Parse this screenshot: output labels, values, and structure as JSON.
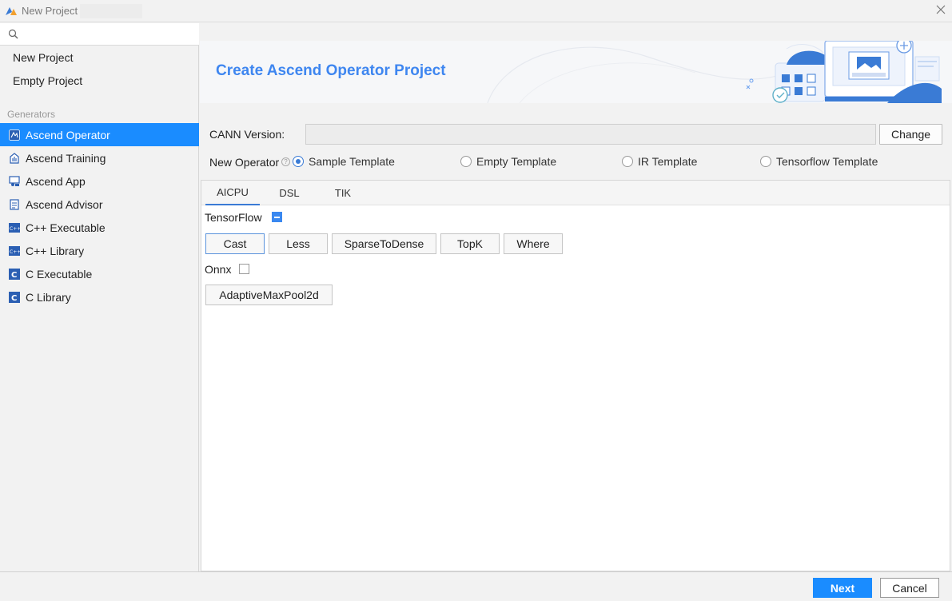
{
  "window": {
    "title": "New Project",
    "app_icon": "ascend-logo-icon",
    "close_icon": "close-icon"
  },
  "sidebar": {
    "search_icon": "search-icon",
    "search_placeholder": "",
    "projects": [
      {
        "label": "New Project"
      },
      {
        "label": "Empty Project"
      }
    ],
    "generators_label": "Generators",
    "generators": [
      {
        "label": "Ascend Operator",
        "icon": "ascend-operator-icon",
        "selected": true
      },
      {
        "label": "Ascend Training",
        "icon": "ascend-training-icon"
      },
      {
        "label": "Ascend App",
        "icon": "ascend-app-icon"
      },
      {
        "label": "Ascend Advisor",
        "icon": "ascend-advisor-icon"
      },
      {
        "label": "C++ Executable",
        "icon": "cpp-icon"
      },
      {
        "label": "C++ Library",
        "icon": "cpp-icon"
      },
      {
        "label": "C Executable",
        "icon": "c-icon"
      },
      {
        "label": "C Library",
        "icon": "c-icon"
      }
    ]
  },
  "banner": {
    "title": "Create Ascend Operator Project"
  },
  "form": {
    "cann_label": "CANN Version:",
    "cann_value": "",
    "change_label": "Change",
    "new_operator_label": "New Operator",
    "templates": [
      {
        "label": "Sample Template",
        "selected": true
      },
      {
        "label": "Empty Template",
        "selected": false
      },
      {
        "label": "IR Template",
        "selected": false
      },
      {
        "label": "Tensorflow Template",
        "selected": false
      }
    ]
  },
  "tabs": [
    {
      "label": "AICPU",
      "active": true
    },
    {
      "label": "DSL",
      "active": false
    },
    {
      "label": "TIK",
      "active": false
    }
  ],
  "groups": {
    "tensorflow": {
      "label": "TensorFlow",
      "state": "indeterminate",
      "ops": [
        "Cast",
        "Less",
        "SparseToDense",
        "TopK",
        "Where"
      ]
    },
    "onnx": {
      "label": "Onnx",
      "state": "unchecked",
      "ops": [
        "AdaptiveMaxPool2d"
      ]
    }
  },
  "footer": {
    "next_label": "Next",
    "cancel_label": "Cancel"
  },
  "colors": {
    "accent": "#1a8cff",
    "banner_title": "#3e86f0"
  }
}
